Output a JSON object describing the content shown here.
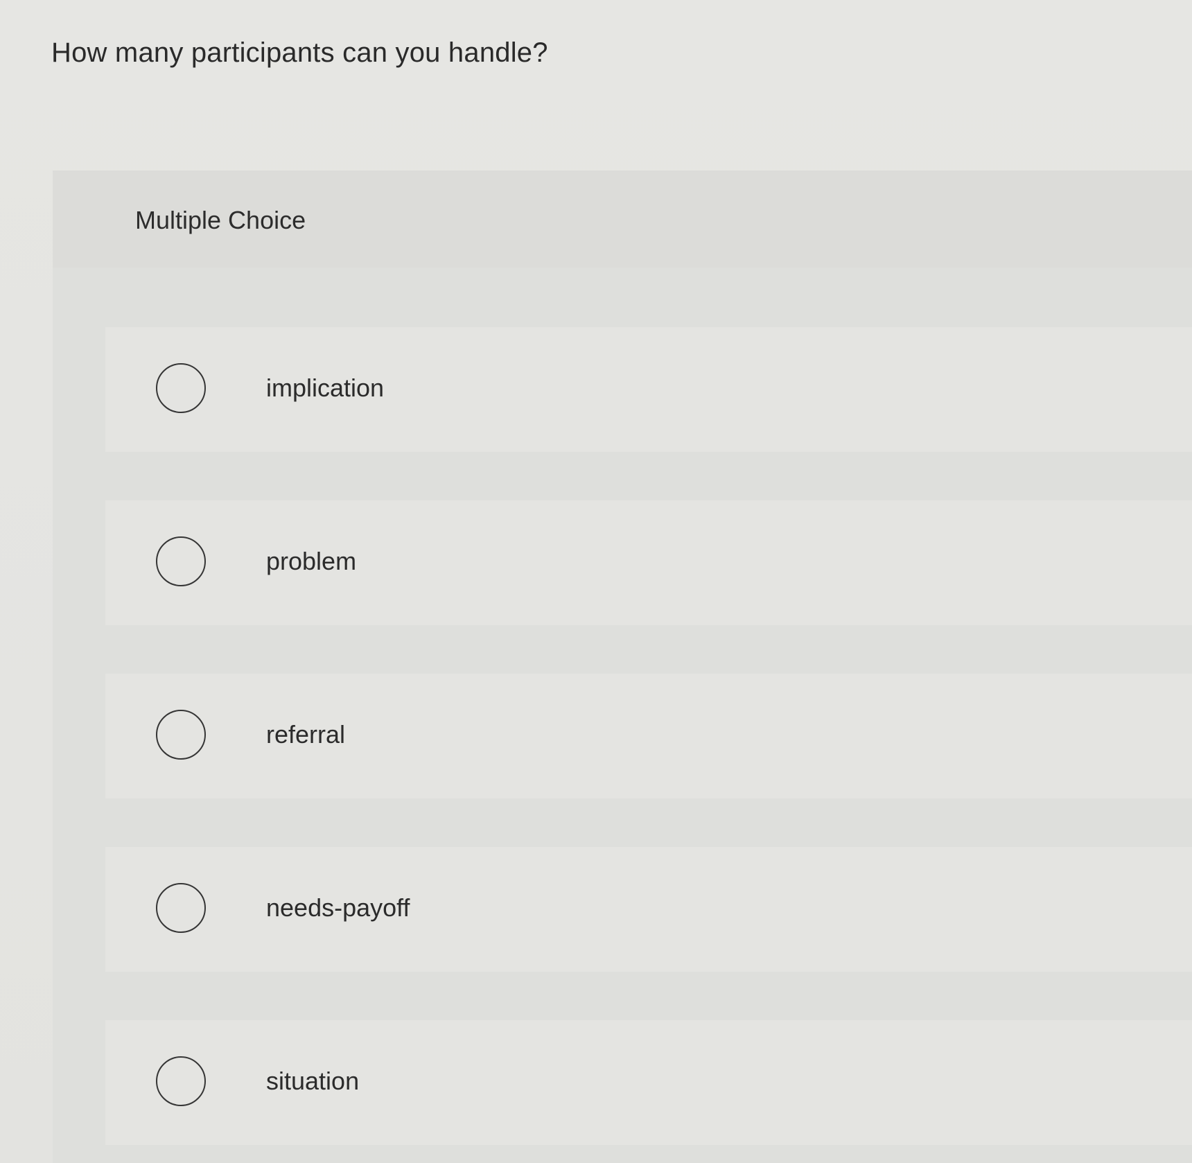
{
  "question": {
    "text": "How many participants can you handle?"
  },
  "multiple_choice": {
    "label": "Multiple Choice",
    "options": [
      {
        "label": "implication",
        "selected": false
      },
      {
        "label": "problem",
        "selected": false
      },
      {
        "label": "referral",
        "selected": false
      },
      {
        "label": "needs-payoff",
        "selected": false
      },
      {
        "label": "situation",
        "selected": false
      }
    ]
  }
}
